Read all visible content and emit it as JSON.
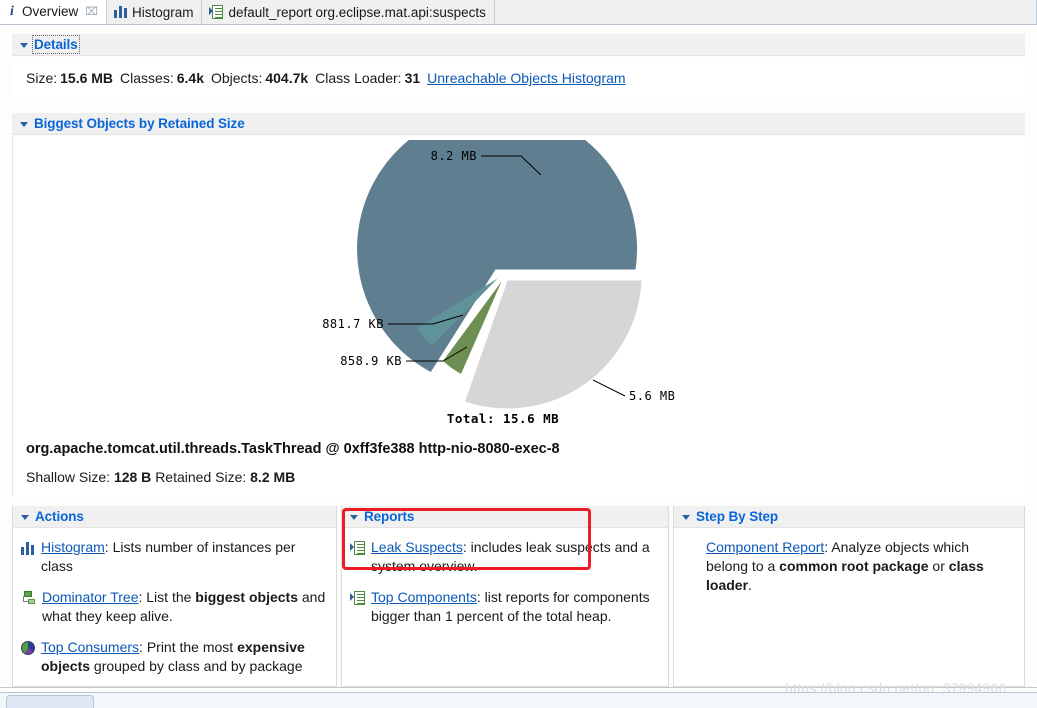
{
  "window": {
    "watermark": "https://blog.csdn.net/qq_37994966"
  },
  "tabs": [
    {
      "label": "Overview",
      "icon": "info-icon",
      "active": true,
      "closeable": true,
      "close_glyph": "⌧"
    },
    {
      "label": "Histogram",
      "icon": "histogram-icon",
      "active": false,
      "closeable": false
    },
    {
      "label": "default_report  org.eclipse.mat.api:suspects",
      "icon": "report-icon",
      "active": false,
      "closeable": false
    }
  ],
  "details": {
    "header": "Details",
    "fields": [
      {
        "key": "Size:",
        "value": "15.6 MB"
      },
      {
        "key": "Classes:",
        "value": "6.4k"
      },
      {
        "key": "Objects:",
        "value": "404.7k"
      },
      {
        "key": "Class Loader:",
        "value": "31"
      }
    ],
    "link": "Unreachable Objects Histogram"
  },
  "biggest_objects": {
    "header": "Biggest Objects by Retained Size",
    "object_title": "org.apache.tomcat.util.threads.TaskThread @ 0xff3fe388 http-nio-8080-exec-8",
    "shallow_label": "Shallow Size:",
    "shallow_value": "128 B",
    "retained_label": "Retained Size:",
    "retained_value": "8.2 MB"
  },
  "chart_data": {
    "type": "pie",
    "title": "Biggest Objects by Retained Size",
    "total_label": "Total: 15.6 MB",
    "total_bytes_mb": 15.6,
    "labels": [
      "8.2 MB",
      "881.7 KB",
      "858.9 KB",
      "5.6 MB"
    ],
    "values": [
      8.2,
      0.861,
      0.839,
      5.6
    ],
    "units": [
      "MB",
      "KB",
      "KB",
      "MB"
    ],
    "colors": [
      "#5f7f91",
      "#5f9299",
      "#6e8f54",
      "#d6d6d6"
    ],
    "legend": "none",
    "grid": false,
    "exploded": true,
    "label_positions": [
      "top-left",
      "left",
      "left",
      "bottom-right"
    ]
  },
  "panels": {
    "actions": {
      "header": "Actions",
      "entries": [
        {
          "icon": "histogram-icon",
          "link": "Histogram",
          "text_after": ": Lists number of instances per class"
        },
        {
          "icon": "dominator-tree-icon",
          "link": "Dominator Tree",
          "text_after": ": List the ",
          "bold1": "biggest objects",
          "text_tail": " and what they keep alive."
        },
        {
          "icon": "top-consumers-icon",
          "link": "Top Consumers",
          "text_after": ": Print the most ",
          "bold1": "expensive objects",
          "text_tail": " grouped by class and by package"
        }
      ]
    },
    "reports": {
      "header": "Reports",
      "entries": [
        {
          "icon": "report-icon",
          "link": "Leak Suspects",
          "text_after": ": includes leak suspects and a system overview."
        },
        {
          "icon": "report-icon",
          "link": "Top Components",
          "text_after": ": list reports for components bigger than 1 percent of the total heap."
        }
      ]
    },
    "step_by_step": {
      "header": "Step By Step",
      "entries": [
        {
          "icon": "none",
          "link": "Component Report",
          "text_after": ": Analyze objects which belong to a ",
          "bold1": "common root package",
          "text_mid": " or ",
          "bold2": "class loader",
          "text_tail": "."
        }
      ]
    }
  },
  "annotation": {
    "type": "red-highlight-rectangle",
    "color": "#ec1c24",
    "targets": "Leak Suspects report entry"
  }
}
